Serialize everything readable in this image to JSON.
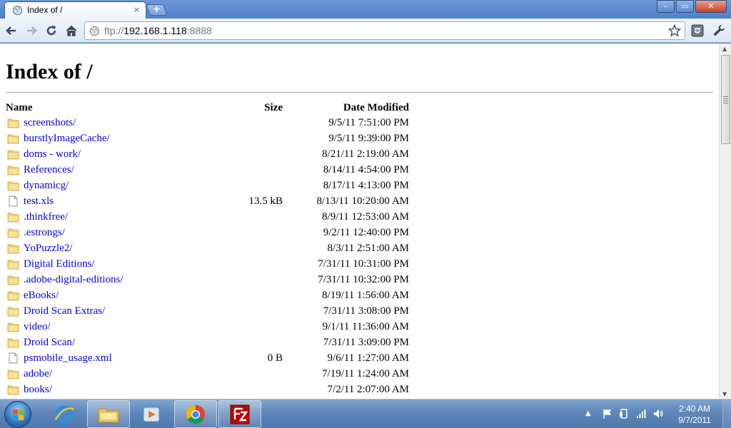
{
  "browser": {
    "tab_title": "Index of /",
    "tab_close": "×",
    "newtab_label": "+",
    "window_controls": {
      "minimize": "–",
      "maximize": "▭",
      "close": "✕"
    },
    "url_scheme": "ftp://",
    "url_host": "192.168.1.118",
    "url_port": ":8888"
  },
  "page": {
    "title": "Index of /",
    "columns": {
      "name": "Name",
      "size": "Size",
      "date": "Date Modified"
    },
    "rows": [
      {
        "name": "screenshots/",
        "size": "",
        "date": "9/5/11 7:51:00 PM",
        "type": "folder"
      },
      {
        "name": "burstlyImageCache/",
        "size": "",
        "date": "9/5/11 9:39:00 PM",
        "type": "folder"
      },
      {
        "name": "doms - work/",
        "size": "",
        "date": "8/21/11 2:19:00 AM",
        "type": "folder"
      },
      {
        "name": "References/",
        "size": "",
        "date": "8/14/11 4:54:00 PM",
        "type": "folder"
      },
      {
        "name": "dynamicg/",
        "size": "",
        "date": "8/17/11 4:13:00 PM",
        "type": "folder"
      },
      {
        "name": "test.xls",
        "size": "13.5 kB",
        "date": "8/13/11 10:20:00 AM",
        "type": "file"
      },
      {
        "name": ".thinkfree/",
        "size": "",
        "date": "8/9/11 12:53:00 AM",
        "type": "folder"
      },
      {
        "name": ".estrongs/",
        "size": "",
        "date": "9/2/11 12:40:00 PM",
        "type": "folder"
      },
      {
        "name": "YoPuzzle2/",
        "size": "",
        "date": "8/3/11 2:51:00 AM",
        "type": "folder"
      },
      {
        "name": "Digital Editions/",
        "size": "",
        "date": "7/31/11 10:31:00 PM",
        "type": "folder"
      },
      {
        "name": ".adobe-digital-editions/",
        "size": "",
        "date": "7/31/11 10:32:00 PM",
        "type": "folder"
      },
      {
        "name": "eBooks/",
        "size": "",
        "date": "8/19/11 1:56:00 AM",
        "type": "folder"
      },
      {
        "name": "Droid Scan Extras/",
        "size": "",
        "date": "7/31/11 3:08:00 PM",
        "type": "folder"
      },
      {
        "name": "video/",
        "size": "",
        "date": "9/1/11 11:36:00 AM",
        "type": "folder"
      },
      {
        "name": "Droid Scan/",
        "size": "",
        "date": "7/31/11 3:09:00 PM",
        "type": "folder"
      },
      {
        "name": "psmobile_usage.xml",
        "size": "0 B",
        "date": "9/6/11 1:27:00 AM",
        "type": "file"
      },
      {
        "name": "adobe/",
        "size": "",
        "date": "7/19/11 1:24:00 AM",
        "type": "folder"
      },
      {
        "name": "books/",
        "size": "",
        "date": "7/2/11 2:07:00 AM",
        "type": "folder"
      }
    ]
  },
  "taskbar": {
    "apps": [
      "internet-explorer",
      "windows-explorer",
      "media-player",
      "chrome",
      "filezilla"
    ],
    "clock_time": "2:40 AM",
    "clock_date": "9/7/2011"
  },
  "colors": {
    "link": "#0000ee",
    "taskbar": "#5f86b8",
    "titlebar": "#4f80c8"
  }
}
